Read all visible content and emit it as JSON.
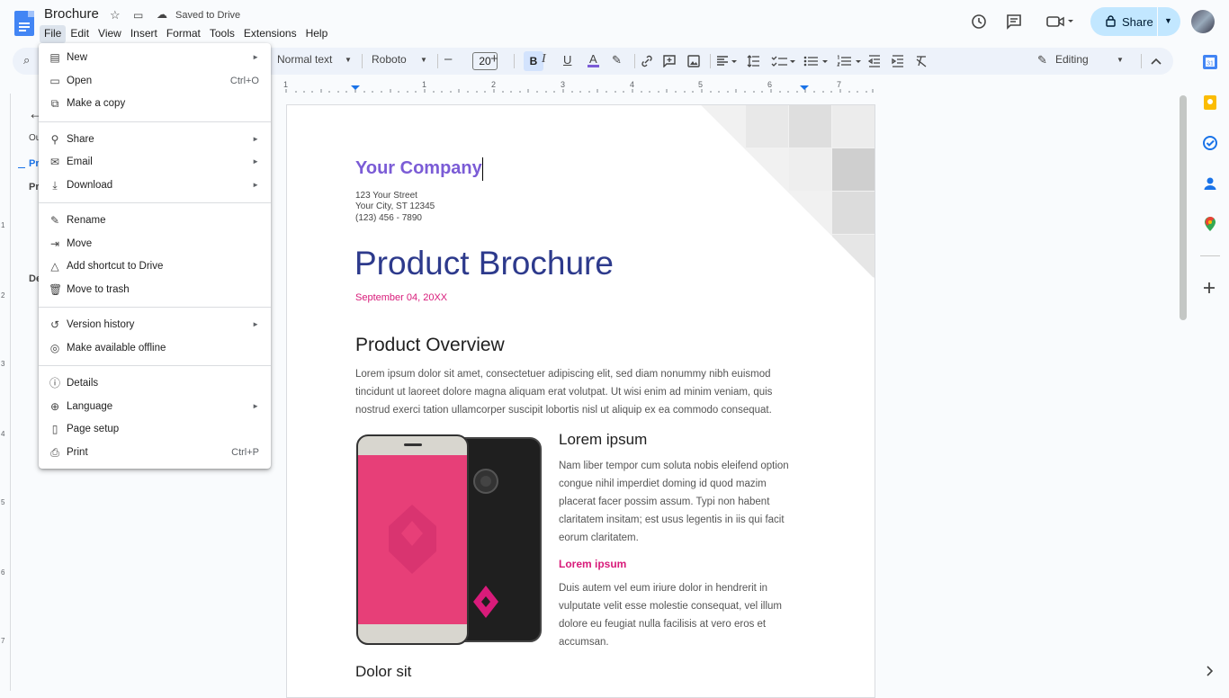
{
  "header": {
    "doc_title": "Brochure",
    "saved_status": "Saved to Drive",
    "share_label": "Share",
    "menu": [
      "File",
      "Edit",
      "View",
      "Insert",
      "Format",
      "Tools",
      "Extensions",
      "Help"
    ]
  },
  "toolbar": {
    "style": "Normal text",
    "font": "Roboto",
    "font_size": "20",
    "mode": "Editing",
    "bold_glyph": "B",
    "italic_glyph": "I",
    "underline_glyph": "U",
    "color_glyph": "A"
  },
  "ruler": {
    "ticks": [
      "1",
      "1",
      "2",
      "3",
      "4",
      "5",
      "6",
      "7"
    ],
    "vticks": [
      "1",
      "2",
      "3",
      "4",
      "5",
      "6",
      "7"
    ]
  },
  "outline": {
    "back_icon": "←",
    "label": "Ou",
    "item1": "Pr",
    "item2": "Pr",
    "item3": "De"
  },
  "file_menu": {
    "items": [
      {
        "label": "New",
        "icon": "document-icon",
        "glyph": "▤",
        "shortcut": "",
        "submenu": true
      },
      {
        "label": "Open",
        "icon": "folder-icon",
        "glyph": "▭",
        "shortcut": "Ctrl+O",
        "submenu": false
      },
      {
        "label": "Make a copy",
        "icon": "copy-icon",
        "glyph": "⧉",
        "shortcut": "",
        "submenu": false
      },
      {
        "label": "Share",
        "icon": "person-add-icon",
        "glyph": "⚲",
        "shortcut": "",
        "submenu": true
      },
      {
        "label": "Email",
        "icon": "mail-icon",
        "glyph": "✉",
        "shortcut": "",
        "submenu": true
      },
      {
        "label": "Download",
        "icon": "download-icon",
        "glyph": "⤓",
        "shortcut": "",
        "submenu": true
      },
      {
        "label": "Rename",
        "icon": "pencil-icon",
        "glyph": "✎",
        "shortcut": "",
        "submenu": false
      },
      {
        "label": "Move",
        "icon": "move-folder-icon",
        "glyph": "⇥",
        "shortcut": "",
        "submenu": false
      },
      {
        "label": "Add shortcut to Drive",
        "icon": "drive-shortcut-icon",
        "glyph": "△",
        "shortcut": "",
        "submenu": false
      },
      {
        "label": "Move to trash",
        "icon": "trash-icon",
        "glyph": "🗑",
        "shortcut": "",
        "submenu": false
      },
      {
        "label": "Version history",
        "icon": "history-icon",
        "glyph": "↺",
        "shortcut": "",
        "submenu": true
      },
      {
        "label": "Make available offline",
        "icon": "offline-icon",
        "glyph": "◎",
        "shortcut": "",
        "submenu": false
      },
      {
        "label": "Details",
        "icon": "info-icon",
        "glyph": "ⓘ",
        "shortcut": "",
        "submenu": false
      },
      {
        "label": "Language",
        "icon": "globe-icon",
        "glyph": "⊕",
        "shortcut": "",
        "submenu": true
      },
      {
        "label": "Page setup",
        "icon": "page-icon",
        "glyph": "▯",
        "shortcut": "",
        "submenu": false
      },
      {
        "label": "Print",
        "icon": "printer-icon",
        "glyph": "⎙",
        "shortcut": "Ctrl+P",
        "submenu": false
      }
    ],
    "submenu_glyph": "►"
  },
  "document": {
    "company": "Your Company",
    "street": "123 Your Street",
    "city": "Your City, ST 12345",
    "phone": "(123) 456 - 7890",
    "title": "Product Brochure",
    "date": "September 04, 20XX",
    "h_overview": "Product Overview",
    "overview_text": "Lorem ipsum dolor sit amet, consectetuer adipiscing elit, sed diam nonummy nibh euismod tincidunt ut laoreet dolore magna aliquam erat volutpat. Ut wisi enim ad minim veniam, quis nostrud exerci tation ullamcorper suscipit lobortis nisl ut aliquip ex ea commodo consequat.",
    "h_lorem": "Lorem ipsum",
    "lorem_text": "Nam liber tempor cum soluta nobis eleifend option congue nihil imperdiet doming id quod mazim placerat facer possim assum. Typi non habent claritatem insitam; est usus legentis in iis qui facit eorum claritatem.",
    "sub_lorem": "Lorem ipsum",
    "sub_text": "Duis autem vel eum iriure dolor in hendrerit in vulputate velit esse molestie consequat, vel illum dolore eu feugiat nulla facilisis at vero eros et accumsan.",
    "h_dolor": "Dolor sit"
  },
  "colors": {
    "accent_purple": "#7b5cd6",
    "title_blue": "#2d3a8c",
    "magenta": "#d81b7a",
    "share_bg": "#c2e7ff"
  }
}
